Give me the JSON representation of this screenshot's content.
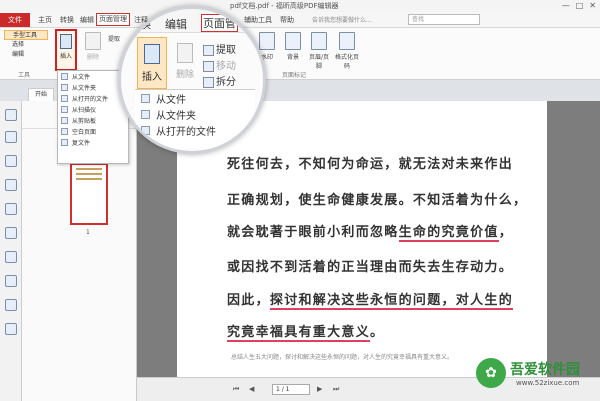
{
  "window": {
    "title": "pdf文档.pdf - 福昕高级PDF编辑器",
    "controls": [
      "—",
      "□",
      "✕"
    ]
  },
  "menubar": {
    "file": "文件",
    "items": [
      "主页",
      "转换",
      "编辑",
      "页面管理",
      "注释",
      "视图",
      "表单",
      "保护",
      "共享",
      "辅助工具",
      "帮助"
    ],
    "active_index": 3,
    "tellme": "告诉我您想要做什么...",
    "search_placeholder": "查找"
  },
  "ribbon": {
    "tools": [
      "手型工具",
      "选择",
      "编辑"
    ],
    "tools_label": "工具",
    "insert": "插入",
    "delete": "删除",
    "extract": "提取",
    "move": "移动",
    "split": "拆分",
    "watermark": "水印",
    "background": "背景",
    "header_footer": "页眉/页脚",
    "format_page_number": "格式化页码",
    "page_marks_label": "页面标记"
  },
  "dropdown": {
    "items": [
      "从文件",
      "从文件夹",
      "从打开的文件",
      "从扫描仪",
      "从剪贴板",
      "空白页面",
      "复文件"
    ]
  },
  "magnifier": {
    "tabs": [
      "转换",
      "编辑",
      "页面管"
    ],
    "insert": "插入",
    "delete": "删除",
    "extract": "提取",
    "move": "移动",
    "split": "拆分",
    "menu_items": [
      "从文件",
      "从文件夹",
      "从打开的文件"
    ]
  },
  "tabs": {
    "start": "开始"
  },
  "thumbnails": {
    "page_number": "1"
  },
  "document": {
    "lines": [
      {
        "text": "死往何去，不知何为命运，就无法对未来作出",
        "highlight": ""
      },
      {
        "text": "正确规划，使生命健康发展。不知活着为什么，",
        "highlight": ""
      },
      {
        "pre": "就会耽著于眼前小利而忽略",
        "hl": "生命的究竟价值",
        "post": "，"
      },
      {
        "text": "或因找不到活着的正当理由而失去生存动力。",
        "highlight": ""
      },
      {
        "pre": "因此，",
        "hl": "探讨和解决这些永恒的问题，对人生的",
        "post": ""
      },
      {
        "pre": "",
        "hl": "究竟幸福具有重大意义",
        "post": "。"
      }
    ],
    "footnote": "总结人生五大问题，探讨和解决这些永恒的问题，对人生的究竟幸福具有重大意义。"
  },
  "statusbar": {
    "page_value": "1 / 1",
    "nav_first": "⏮",
    "nav_prev": "◀",
    "nav_next": "▶",
    "nav_last": "⏭"
  },
  "watermark": {
    "logo": "✿",
    "name": "吾爱软件园",
    "url": "www.52zixue.com"
  }
}
